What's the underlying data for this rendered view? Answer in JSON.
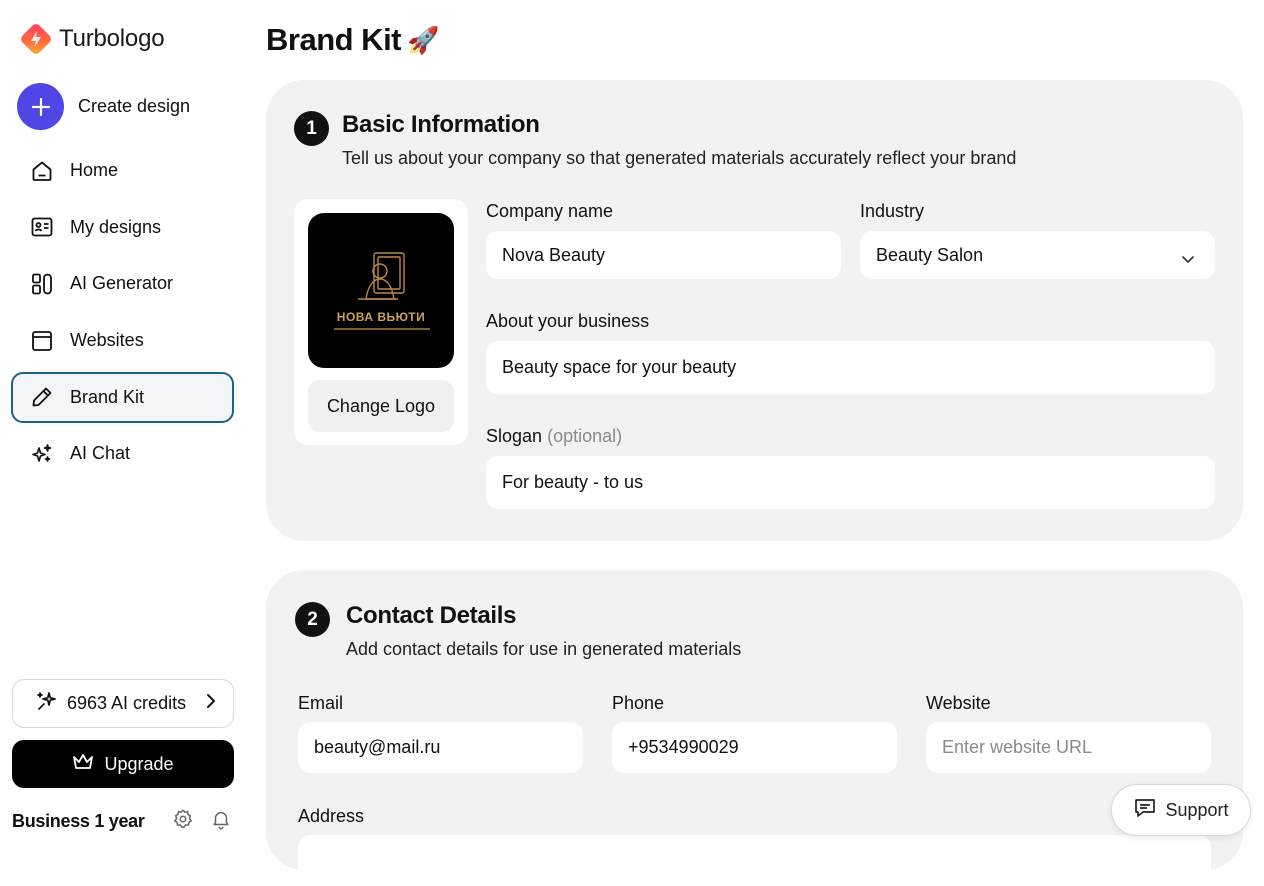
{
  "brand": {
    "name": "Turbologo"
  },
  "sidebar": {
    "create_label": "Create design",
    "items": [
      {
        "label": "Home",
        "icon": "home-icon"
      },
      {
        "label": "My designs",
        "icon": "id-card-icon"
      },
      {
        "label": "AI Generator",
        "icon": "layout-icon"
      },
      {
        "label": "Websites",
        "icon": "browser-window-icon"
      },
      {
        "label": "Brand Kit",
        "icon": "pen-icon",
        "active": true
      },
      {
        "label": "AI Chat",
        "icon": "sparkles-icon"
      }
    ],
    "credits_label": "6963 AI credits",
    "upgrade_label": "Upgrade",
    "plan_label": "Business 1 year"
  },
  "page": {
    "title": "Brand Kit",
    "title_emoji": "🚀"
  },
  "section1": {
    "number": "1",
    "title": "Basic Information",
    "subtitle": "Tell us about your company so that generated materials accurately reflect your brand",
    "logo_text": "НОВА ВЬЮТИ",
    "change_logo_label": "Change Logo",
    "company_label": "Company name",
    "company_value": "Nova Beauty",
    "industry_label": "Industry",
    "industry_value": "Beauty Salon",
    "about_label": "About your business",
    "about_value": "Beauty space for your beauty",
    "slogan_label": "Slogan",
    "slogan_optional": "(optional)",
    "slogan_value": "For beauty - to us"
  },
  "section2": {
    "number": "2",
    "title": "Contact Details",
    "subtitle": "Add contact details for use in generated materials",
    "email_label": "Email",
    "email_value": "beauty@mail.ru",
    "phone_label": "Phone",
    "phone_value": "+9534990029",
    "website_label": "Website",
    "website_placeholder": "Enter website URL",
    "address_label": "Address"
  },
  "support_label": "Support",
  "colors": {
    "accent": "#4f46e5",
    "active_border": "#1f5f8b",
    "card_bg": "#f2f2f0",
    "logo_gold": "#c9a25a"
  }
}
